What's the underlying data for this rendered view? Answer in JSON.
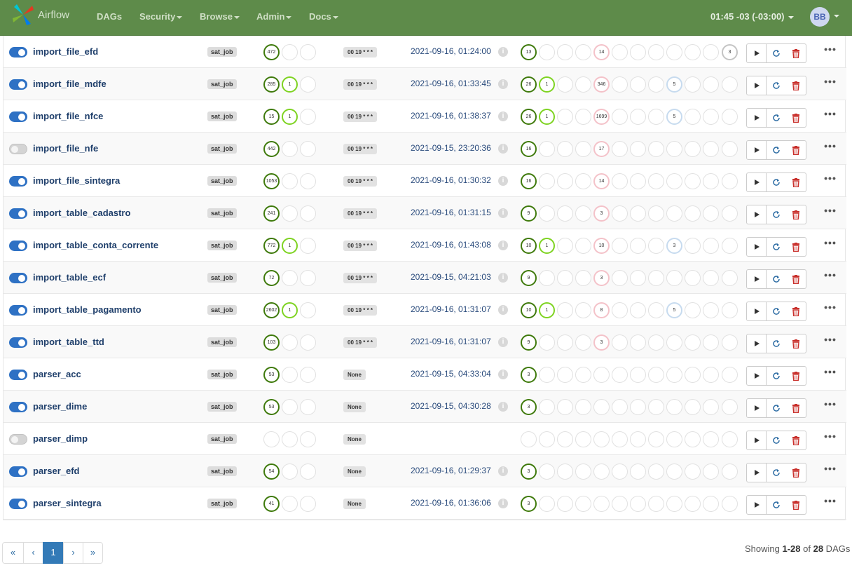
{
  "navbar": {
    "brand": "Airflow",
    "items": [
      "DAGs",
      "Security",
      "Browse",
      "Admin",
      "Docs"
    ],
    "clock": "01:45 -03 (-03:00)",
    "avatar": "BB"
  },
  "dags": [
    {
      "name": "import_file_efd",
      "active": true,
      "tag": "sat_job",
      "runs": [
        "472",
        "",
        ""
      ],
      "schedule": "00 19 * * *",
      "last_run": "2021-09-16, 01:24:00",
      "tasks": [
        "13",
        "",
        "",
        "",
        "14",
        "",
        "",
        "",
        "",
        "",
        "",
        "3"
      ]
    },
    {
      "name": "import_file_mdfe",
      "active": true,
      "tag": "sat_job",
      "runs": [
        "285",
        "1",
        ""
      ],
      "schedule": "00 19 * * *",
      "last_run": "2021-09-16, 01:33:45",
      "tasks": [
        "26",
        "1",
        "",
        "",
        "346",
        "",
        "",
        "",
        "5",
        "",
        "",
        ""
      ]
    },
    {
      "name": "import_file_nfce",
      "active": true,
      "tag": "sat_job",
      "runs": [
        "15",
        "1",
        ""
      ],
      "schedule": "00 19 * * *",
      "last_run": "2021-09-16, 01:38:37",
      "tasks": [
        "26",
        "1",
        "",
        "",
        "1699",
        "",
        "",
        "",
        "5",
        "",
        "",
        ""
      ]
    },
    {
      "name": "import_file_nfe",
      "active": false,
      "tag": "sat_job",
      "runs": [
        "442",
        "",
        ""
      ],
      "schedule": "00 19 * * *",
      "last_run": "2021-09-15, 23:20:36",
      "tasks": [
        "16",
        "",
        "",
        "",
        "17",
        "",
        "",
        "",
        "",
        "",
        "",
        ""
      ]
    },
    {
      "name": "import_file_sintegra",
      "active": true,
      "tag": "sat_job",
      "runs": [
        "1053",
        "",
        ""
      ],
      "schedule": "00 19 * * *",
      "last_run": "2021-09-16, 01:30:32",
      "tasks": [
        "16",
        "",
        "",
        "",
        "14",
        "",
        "",
        "",
        "",
        "",
        "",
        ""
      ]
    },
    {
      "name": "import_table_cadastro",
      "active": true,
      "tag": "sat_job",
      "runs": [
        "241",
        "",
        ""
      ],
      "schedule": "00 19 * * *",
      "last_run": "2021-09-16, 01:31:15",
      "tasks": [
        "9",
        "",
        "",
        "",
        "3",
        "",
        "",
        "",
        "",
        "",
        "",
        ""
      ]
    },
    {
      "name": "import_table_conta_corrente",
      "active": true,
      "tag": "sat_job",
      "runs": [
        "772",
        "1",
        ""
      ],
      "schedule": "00 19 * * *",
      "last_run": "2021-09-16, 01:43:08",
      "tasks": [
        "10",
        "1",
        "",
        "",
        "10",
        "",
        "",
        "",
        "3",
        "",
        "",
        ""
      ]
    },
    {
      "name": "import_table_ecf",
      "active": true,
      "tag": "sat_job",
      "runs": [
        "72",
        "",
        ""
      ],
      "schedule": "00 19 * * *",
      "last_run": "2021-09-15, 04:21:03",
      "tasks": [
        "9",
        "",
        "",
        "",
        "3",
        "",
        "",
        "",
        "",
        "",
        "",
        ""
      ]
    },
    {
      "name": "import_table_pagamento",
      "active": true,
      "tag": "sat_job",
      "runs": [
        "2602",
        "1",
        ""
      ],
      "schedule": "00 19 * * *",
      "last_run": "2021-09-16, 01:31:07",
      "tasks": [
        "10",
        "1",
        "",
        "",
        "8",
        "",
        "",
        "",
        "5",
        "",
        "",
        ""
      ]
    },
    {
      "name": "import_table_ttd",
      "active": true,
      "tag": "sat_job",
      "runs": [
        "103",
        "",
        ""
      ],
      "schedule": "00 19 * * *",
      "last_run": "2021-09-16, 01:31:07",
      "tasks": [
        "9",
        "",
        "",
        "",
        "3",
        "",
        "",
        "",
        "",
        "",
        "",
        ""
      ]
    },
    {
      "name": "parser_acc",
      "active": true,
      "tag": "sat_job",
      "runs": [
        "53",
        "",
        ""
      ],
      "schedule": "None",
      "last_run": "2021-09-15, 04:33:04",
      "tasks": [
        "3",
        "",
        "",
        "",
        "",
        "",
        "",
        "",
        "",
        "",
        "",
        ""
      ]
    },
    {
      "name": "parser_dime",
      "active": true,
      "tag": "sat_job",
      "runs": [
        "53",
        "",
        ""
      ],
      "schedule": "None",
      "last_run": "2021-09-15, 04:30:28",
      "tasks": [
        "3",
        "",
        "",
        "",
        "",
        "",
        "",
        "",
        "",
        "",
        "",
        ""
      ]
    },
    {
      "name": "parser_dimp",
      "active": false,
      "tag": "sat_job",
      "runs": [
        "",
        "",
        ""
      ],
      "schedule": "None",
      "last_run": "",
      "tasks": [
        "",
        "",
        "",
        "",
        "",
        "",
        "",
        "",
        "",
        "",
        "",
        ""
      ]
    },
    {
      "name": "parser_efd",
      "active": true,
      "tag": "sat_job",
      "runs": [
        "54",
        "",
        ""
      ],
      "schedule": "None",
      "last_run": "2021-09-16, 01:29:37",
      "tasks": [
        "3",
        "",
        "",
        "",
        "",
        "",
        "",
        "",
        "",
        "",
        "",
        ""
      ]
    },
    {
      "name": "parser_sintegra",
      "active": true,
      "tag": "sat_job",
      "runs": [
        "41",
        "",
        ""
      ],
      "schedule": "None",
      "last_run": "2021-09-16, 01:36:06",
      "tasks": [
        "3",
        "",
        "",
        "",
        "",
        "",
        "",
        "",
        "",
        "",
        "",
        ""
      ]
    }
  ],
  "run_states": [
    "success",
    "running",
    "failed"
  ],
  "task_states": [
    "success",
    "running",
    "queued",
    "up_for_retry",
    "failed",
    "upstream_failed",
    "scheduled",
    "removed",
    "skipped",
    "deferred",
    "sensing",
    "upstream"
  ],
  "colors": {
    "success": "#3f7a0c",
    "running": "#7ed321",
    "failed": "#f4c2c9",
    "skipped": "#c7dbef",
    "accent": "#2e71c4",
    "navbar": "#5e8b4a"
  },
  "pagination": {
    "items": [
      "«",
      "‹",
      "1",
      "›",
      "»"
    ],
    "active": "1"
  },
  "footer": {
    "prefix": "Showing ",
    "range": "1-28",
    "of": " of ",
    "total": "28",
    "suffix": " DAGs"
  }
}
